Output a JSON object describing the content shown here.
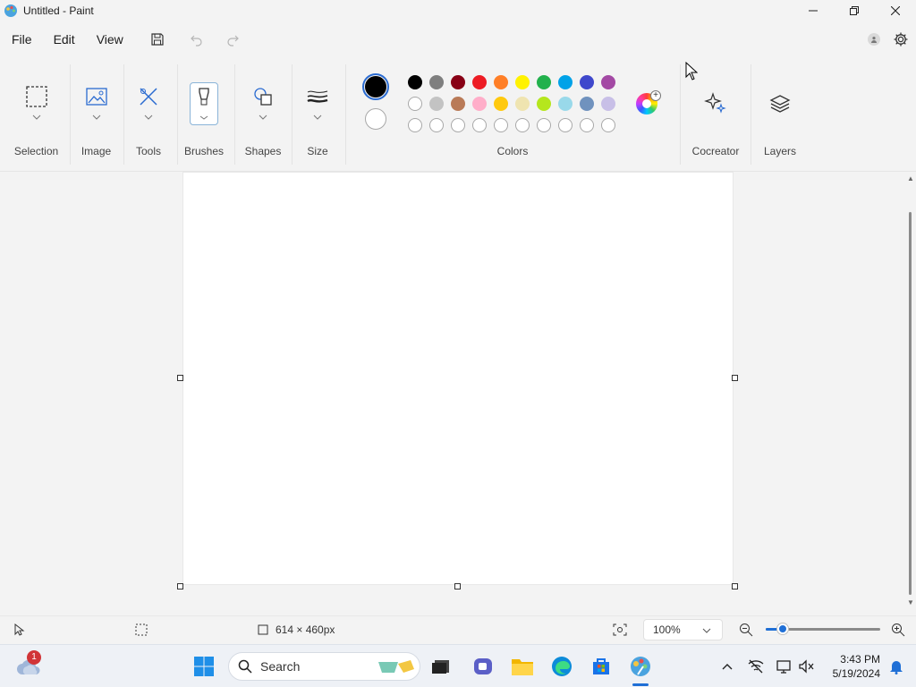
{
  "window": {
    "title": "Untitled - Paint",
    "controls": [
      "minimize-icon",
      "restore-icon",
      "close-icon"
    ]
  },
  "menubar": {
    "items": [
      "File",
      "Edit",
      "View"
    ],
    "quick_actions": [
      "save-icon",
      "undo-icon",
      "redo-icon"
    ],
    "right_icons": [
      "account-icon",
      "settings-icon"
    ]
  },
  "ribbon": {
    "groups": [
      {
        "label": "Selection",
        "icon": "selection-icon"
      },
      {
        "label": "Image",
        "icon": "image-icon"
      },
      {
        "label": "Tools",
        "icon": "tools-icon"
      },
      {
        "label": "Brushes",
        "icon": "brush-icon"
      },
      {
        "label": "Shapes",
        "icon": "shapes-icon"
      },
      {
        "label": "Size",
        "icon": "size-icon"
      },
      {
        "label": "Colors",
        "icon": "colors-icon"
      },
      {
        "label": "Cocreator",
        "icon": "sparkle-icon"
      },
      {
        "label": "Layers",
        "icon": "layers-icon"
      }
    ],
    "colors": {
      "primary": "#000000",
      "secondary": "#ffffff",
      "row1": [
        "#000000",
        "#7f7f7f",
        "#880015",
        "#ed1c24",
        "#ff7f27",
        "#fff200",
        "#22b14c",
        "#00a2e8",
        "#3f48cc",
        "#a349a4"
      ],
      "row2": [
        "#ffffff",
        "#c3c3c3",
        "#b97a57",
        "#ffaec9",
        "#ffc90e",
        "#efe4b0",
        "#b5e61d",
        "#99d9ea",
        "#7092be",
        "#c8bfe7"
      ],
      "row3_custom_slots": 10
    }
  },
  "statusbar": {
    "canvas_size": "614 × 460px",
    "zoom": "100%",
    "zoom_slider_fraction": 0.15
  },
  "taskbar": {
    "search_placeholder": "Search",
    "weather_badge": "1",
    "clock_time": "3:43 PM",
    "clock_date": "5/19/2024",
    "apps": [
      "start-icon",
      "search-icon",
      "widgets-icon",
      "task-view-icon",
      "teams-icon",
      "file-explorer-icon",
      "edge-icon",
      "store-icon",
      "paint-icon"
    ],
    "tray": [
      "chevron-up-icon",
      "network-off-icon",
      "display-icon",
      "volume-mute-icon",
      "notification-bell-icon"
    ]
  }
}
